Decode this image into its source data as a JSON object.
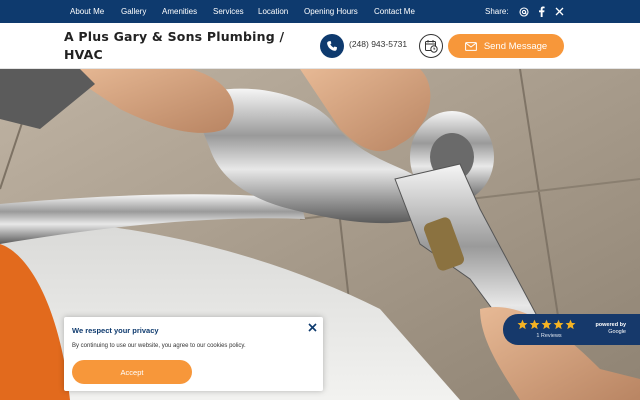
{
  "nav": {
    "links": [
      "About Me",
      "Gallery",
      "Amenities",
      "Services",
      "Location",
      "Opening Hours",
      "Contact Me"
    ],
    "share_label": "Share:",
    "share_icons": [
      "at-sign-icon",
      "facebook-icon",
      "x-twitter-icon"
    ]
  },
  "header": {
    "business_name": "A Plus Gary & Sons Plumbing / HVAC",
    "phone": "(248) 943-5731",
    "phone_icon": "phone-icon",
    "booking_icon": "calendar-clock-icon",
    "send_message_label": "Send Message",
    "send_message_icon": "envelope-icon"
  },
  "hero": {
    "image_subject": "hands tightening a chrome faucet with an adjustable wrench"
  },
  "reviews_badge": {
    "rating_stars": 5,
    "reviews_count_text": "1 Reviews",
    "powered_by": "powered by",
    "provider": "Google"
  },
  "cookie_banner": {
    "title": "We respect your privacy",
    "text": "By continuing to use our website, you agree to our cookies policy.",
    "accept_label": "Accept",
    "close_icon": "close-icon"
  },
  "colors": {
    "navy": "#0e3a6e",
    "orange": "#f7973a",
    "badge_blue": "#16396b",
    "star_gold": "#f5b323"
  }
}
